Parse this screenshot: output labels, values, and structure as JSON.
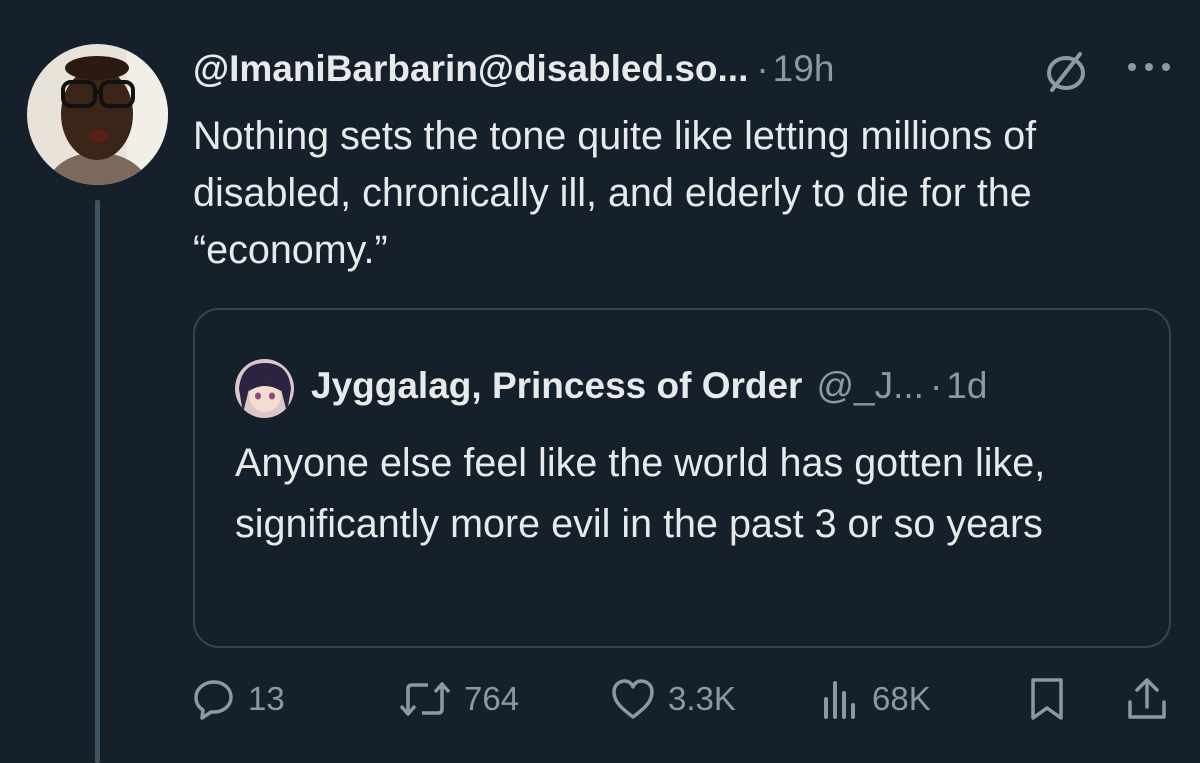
{
  "tweet": {
    "handle": "@ImaniBarbarin@disabled.so...",
    "separator": "·",
    "time": "19h",
    "text": "Nothing sets the tone quite like letting millions of disabled, chronically ill, and elderly to die for the “economy.”",
    "avatar_icon": "user-photo-avatar"
  },
  "quoted": {
    "name": "Jyggalag, Princess of Order",
    "handle": "@_J...",
    "separator": "·",
    "time": "1d",
    "text": "Anyone else feel like the world has gotten like, significantly more evil in the past 3 or so years",
    "avatar_icon": "anime-avatar"
  },
  "actions": {
    "reply_count": "13",
    "retweet_count": "764",
    "like_count": "3.3K",
    "views_count": "68K"
  },
  "icons": {
    "header": [
      "circle-slash-icon",
      "more-icon"
    ],
    "actions": [
      "reply-icon",
      "retweet-icon",
      "like-icon",
      "views-icon",
      "bookmark-icon",
      "share-icon"
    ]
  },
  "colors": {
    "background": "#15202b",
    "text": "#e7e9ea",
    "secondary_text": "#8b98a5",
    "border": "#38444d",
    "thread_line": "#425364"
  }
}
